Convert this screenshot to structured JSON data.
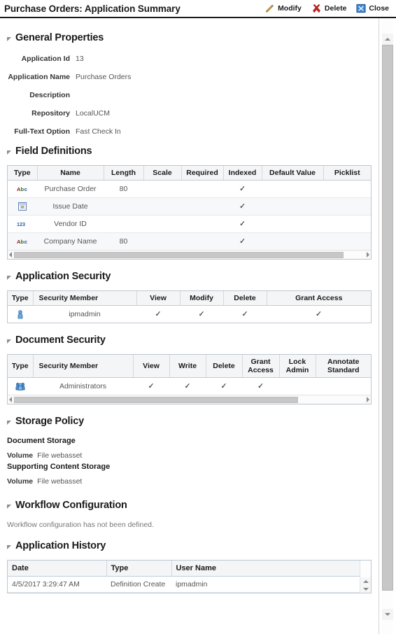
{
  "header": {
    "title": "Purchase Orders: Application Summary",
    "actions": [
      {
        "label": "Modify",
        "icon": "pencil-icon"
      },
      {
        "label": "Delete",
        "icon": "red-x-icon"
      },
      {
        "label": "Close",
        "icon": "close-box-icon"
      }
    ]
  },
  "sections": {
    "general": {
      "title": "General Properties",
      "rows": [
        {
          "label": "Application Id",
          "value": "13"
        },
        {
          "label": "Application Name",
          "value": "Purchase Orders"
        },
        {
          "label": "Description",
          "value": ""
        },
        {
          "label": "Repository",
          "value": "LocalUCM"
        },
        {
          "label": "Full-Text Option",
          "value": "Fast Check In"
        }
      ]
    },
    "fields": {
      "title": "Field Definitions",
      "columns": [
        "Type",
        "Name",
        "Length",
        "Scale",
        "Required",
        "Indexed",
        "Default Value",
        "Picklist"
      ],
      "rows": [
        {
          "type_icon": "text-type-icon",
          "name": "Purchase Order",
          "length": "80",
          "scale": "",
          "required": "",
          "indexed": "✓",
          "default_value": "",
          "picklist": ""
        },
        {
          "type_icon": "date-type-icon",
          "name": "Issue Date",
          "length": "",
          "scale": "",
          "required": "",
          "indexed": "✓",
          "default_value": "",
          "picklist": ""
        },
        {
          "type_icon": "number-type-icon",
          "name": "Vendor ID",
          "length": "",
          "scale": "",
          "required": "",
          "indexed": "✓",
          "default_value": "",
          "picklist": ""
        },
        {
          "type_icon": "text-type-icon",
          "name": "Company Name",
          "length": "80",
          "scale": "",
          "required": "",
          "indexed": "✓",
          "default_value": "",
          "picklist": ""
        }
      ]
    },
    "app_security": {
      "title": "Application Security",
      "columns": [
        "Type",
        "Security Member",
        "View",
        "Modify",
        "Delete",
        "Grant Access"
      ],
      "rows": [
        {
          "type_icon": "user-icon",
          "member": "ipmadmin",
          "view": "✓",
          "modify": "✓",
          "delete": "✓",
          "grant_access": "✓"
        }
      ]
    },
    "doc_security": {
      "title": "Document Security",
      "columns": [
        "Type",
        "Security Member",
        "View",
        "Write",
        "Delete",
        "Grant Access",
        "Lock Admin",
        "Annotate Standard"
      ],
      "rows": [
        {
          "type_icon": "group-icon",
          "member": "Administrators",
          "view": "✓",
          "write": "✓",
          "delete": "✓",
          "grant_access": "✓",
          "lock_admin": "",
          "annotate_standard": ""
        }
      ]
    },
    "storage": {
      "title": "Storage Policy",
      "document_storage": {
        "heading": "Document Storage",
        "volume_label": "Volume",
        "volume_value": "File webasset"
      },
      "supporting_storage": {
        "heading": "Supporting Content Storage",
        "volume_label": "Volume",
        "volume_value": "File webasset"
      }
    },
    "workflow": {
      "title": "Workflow Configuration",
      "message": "Workflow configuration has not been defined."
    },
    "history": {
      "title": "Application History",
      "columns": [
        "Date",
        "Type",
        "User Name"
      ],
      "rows": [
        {
          "date": "4/5/2017 3:29:47 AM",
          "type": "Definition Create",
          "user_name": "ipmadmin"
        }
      ]
    }
  },
  "colors": {
    "check_green": "#4a9a2e",
    "delete_red": "#cc2222",
    "close_blue": "#2a74c8",
    "pencil_orange": "#e8a33d",
    "header_bg": "#f4f5f7",
    "border": "#bcc7d2"
  }
}
